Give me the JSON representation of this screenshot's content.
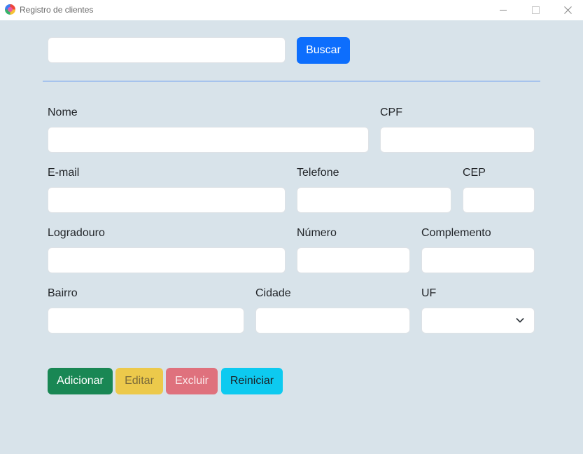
{
  "window": {
    "title": "Registro de clientes"
  },
  "search": {
    "value": "",
    "button_label": "Buscar"
  },
  "form": {
    "nome": {
      "label": "Nome",
      "value": ""
    },
    "cpf": {
      "label": "CPF",
      "value": ""
    },
    "email": {
      "label": "E-mail",
      "value": ""
    },
    "telefone": {
      "label": "Telefone",
      "value": ""
    },
    "cep": {
      "label": "CEP",
      "value": ""
    },
    "logradouro": {
      "label": "Logradouro",
      "value": ""
    },
    "numero": {
      "label": "Número",
      "value": ""
    },
    "complemento": {
      "label": "Complemento",
      "value": ""
    },
    "bairro": {
      "label": "Bairro",
      "value": ""
    },
    "cidade": {
      "label": "Cidade",
      "value": ""
    },
    "uf": {
      "label": "UF",
      "value": ""
    }
  },
  "actions": {
    "add_label": "Adicionar",
    "edit_label": "Editar",
    "delete_label": "Excluir",
    "reset_label": "Reiniciar"
  },
  "colors": {
    "background": "#d8e3ea",
    "primary": "#0d6efd",
    "success": "#198754",
    "warning_disabled": "#ecc94b",
    "danger_disabled": "#df717d",
    "info": "#0dcaf0",
    "divider": "#a6c3ed"
  }
}
